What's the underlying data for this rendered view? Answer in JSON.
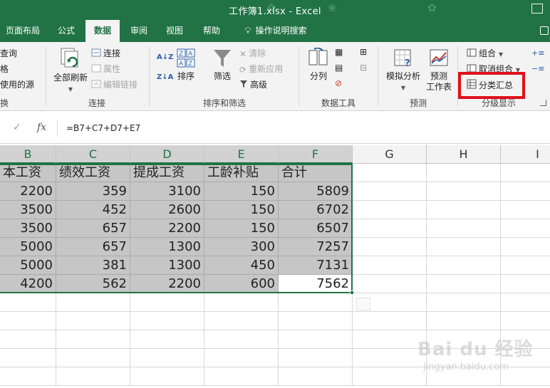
{
  "window": {
    "title": "工作簿1.xlsx  -  Excel"
  },
  "tabs": [
    {
      "label": "页面布局",
      "active": false
    },
    {
      "label": "公式",
      "active": false
    },
    {
      "label": "数据",
      "active": true
    },
    {
      "label": "审阅",
      "active": false
    },
    {
      "label": "视图",
      "active": false
    },
    {
      "label": "帮助",
      "active": false
    }
  ],
  "tell_me": {
    "label": "操作说明搜索",
    "icon": "lightbulb-icon"
  },
  "ribbon": {
    "get_group": {
      "items": [
        "查询",
        "格",
        "使用的源"
      ],
      "label": "换"
    },
    "connections_group": {
      "refresh_all": "全部刷新",
      "connections": "连接",
      "properties": "属性",
      "edit_links": "编辑链接",
      "label": "连接"
    },
    "sort_filter_group": {
      "sort": "排序",
      "filter": "筛选",
      "clear": "清除",
      "reapply": "重新应用",
      "advanced": "高级",
      "label": "排序和筛选"
    },
    "data_tools_group": {
      "text_to_columns": "分列",
      "label": "数据工具"
    },
    "forecast_group": {
      "what_if": "模拟分析",
      "forecast_sheet_1": "预测",
      "forecast_sheet_2": "工作表",
      "label": "预测"
    },
    "outline_group": {
      "group": "组合",
      "ungroup": "取消组合",
      "subtotal": "分类汇总",
      "label": "分级显示"
    }
  },
  "formula_bar": {
    "formula": "=B7+C7+D7+E7",
    "cancel_icon": "✓",
    "fx": "fx"
  },
  "columns": [
    "B",
    "C",
    "D",
    "E",
    "F",
    "G",
    "H",
    "I"
  ],
  "table": {
    "headers": [
      "本工资",
      "绩效工资",
      "提成工资",
      "工龄补贴",
      "合计"
    ],
    "rows": [
      [
        "2200",
        "359",
        "3100",
        "150",
        "5809"
      ],
      [
        "3500",
        "452",
        "2600",
        "150",
        "6702"
      ],
      [
        "3500",
        "657",
        "2200",
        "150",
        "6507"
      ],
      [
        "5000",
        "657",
        "1300",
        "300",
        "7257"
      ],
      [
        "5000",
        "381",
        "1300",
        "450",
        "7131"
      ],
      [
        "4200",
        "562",
        "2200",
        "600",
        "7562"
      ]
    ]
  },
  "watermark": {
    "main": "Bai du 经验",
    "sub": "jingyan.baidu.com"
  },
  "colors": {
    "excel_green": "#217346",
    "highlight": "#e0101a",
    "selection": "#c6c6c6"
  }
}
